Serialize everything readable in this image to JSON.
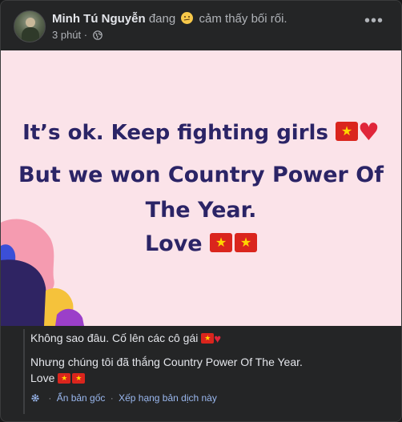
{
  "post": {
    "author": "Minh Tú Nguyễn",
    "feeling_prefix": "đang",
    "feeling_text": "cảm thấy bối rối.",
    "feeling_icon": "confused-face-emoji",
    "time": "3 phút",
    "privacy_icon": "globe-icon",
    "more_icon": "more-options-icon",
    "more_label": "•••"
  },
  "image": {
    "line1": "It’s ok. Keep fighting girls",
    "line2": "But we won Country Power Of",
    "line3": "The Year.",
    "line4": "Love",
    "flag_icon": "vietnam-flag-emoji",
    "heart_icon": "red-heart-emoji",
    "background_color": "#fbe3e9",
    "text_color": "#2b2466"
  },
  "translation": {
    "line1": "Không sao đâu. Cố lên các cô gái",
    "line2": "Nhưng chúng tôi đã thắng Country Power Of The Year.",
    "line3": "Love",
    "hide_original": "Ẩn bản gốc",
    "separator": "·",
    "rate_translation": "Xếp hạng bản dịch này",
    "link_color": "#9ab8ef"
  }
}
